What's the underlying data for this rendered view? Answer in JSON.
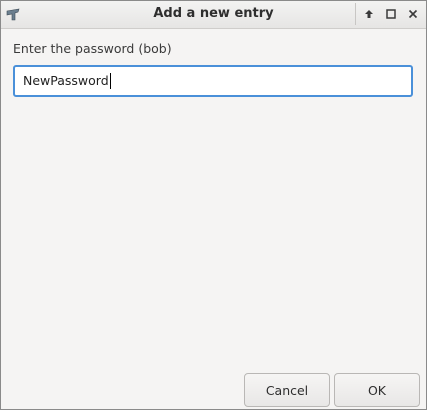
{
  "window": {
    "title": "Add a new entry"
  },
  "titlebar": {
    "icons": [
      "app-icon",
      "keep-above-icon",
      "maximize-icon",
      "close-icon"
    ]
  },
  "form": {
    "prompt": "Enter the password (bob)",
    "password_value": "NewPassword"
  },
  "buttons": {
    "cancel_label": "Cancel",
    "ok_label": "OK"
  },
  "colors": {
    "focus_border": "#4a90d9",
    "window_bg": "#f5f4f3"
  }
}
